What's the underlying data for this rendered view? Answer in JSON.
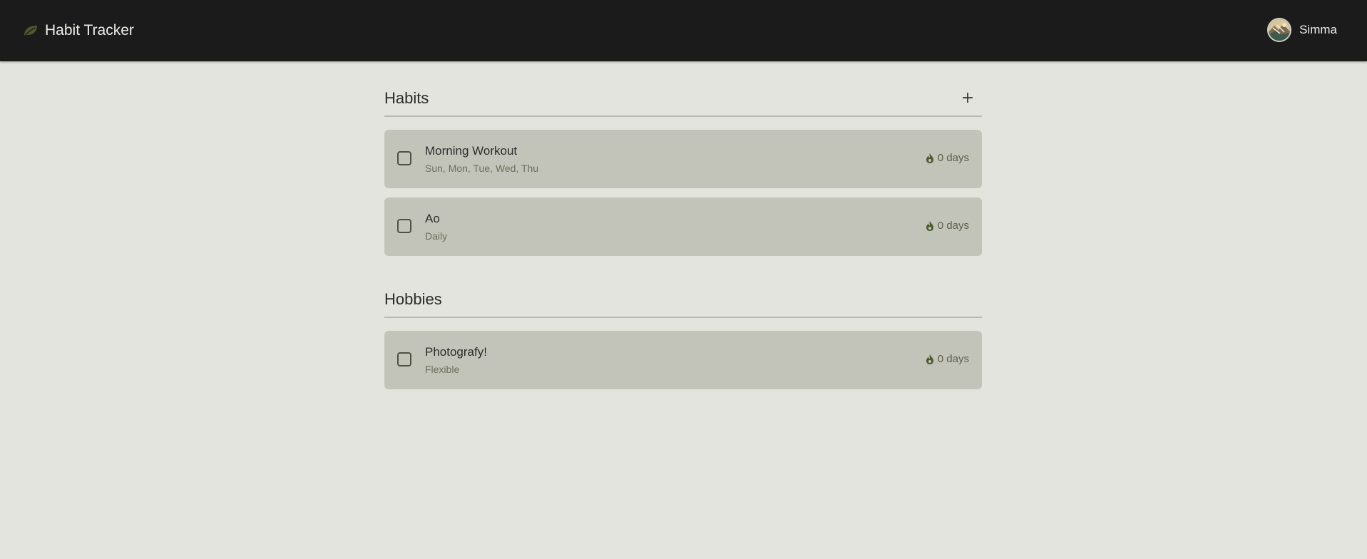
{
  "app": {
    "title": "Habit Tracker",
    "brand_icon": "leaf-icon",
    "accent_color": "#4d5a2e",
    "header_bg": "#1b1b1b",
    "page_bg": "#e3e4dd",
    "card_bg": "#c3c4b9"
  },
  "user": {
    "name": "Simma",
    "avatar_icon": "avatar"
  },
  "sections": [
    {
      "title": "Habits",
      "has_add_button": true,
      "add_label": "+",
      "items": [
        {
          "name": "Morning Workout",
          "schedule": "Sun, Mon, Tue, Wed, Thu",
          "streak": "0 days",
          "checked": false
        },
        {
          "name": "Ao",
          "schedule": "Daily",
          "streak": "0 days",
          "checked": false
        }
      ]
    },
    {
      "title": "Hobbies",
      "has_add_button": false,
      "items": [
        {
          "name": "Photografy!",
          "schedule": "Flexible",
          "streak": "0 days",
          "checked": false
        }
      ]
    }
  ]
}
